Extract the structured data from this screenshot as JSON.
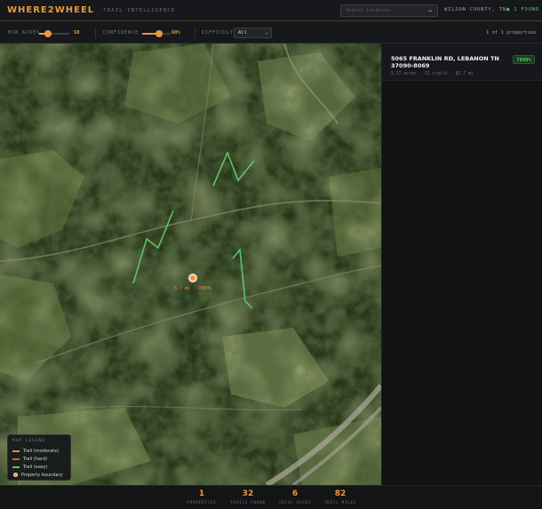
{
  "header": {
    "logo": "WHERE2WHEEL",
    "tagline": "TRAIL INTELLIGENCE",
    "search_placeholder": "Search location...",
    "search_go": "→",
    "county": "WILSON COUNTY, TN",
    "found": "● 1 FOUND"
  },
  "filters": {
    "min_acres": {
      "label": "MIN ACRES",
      "value": "50",
      "level": 0.3
    },
    "confidence": {
      "label": "CONFIDENCE",
      "value": "60%",
      "level": 0.6
    },
    "difficulty": {
      "label": "DIFFICULTY",
      "selected": "All"
    },
    "count": "1 of 1 properties"
  },
  "map": {
    "marker_label": "5.7 mi · 7800%",
    "legend": {
      "title": "MAP LEGEND",
      "items": [
        {
          "label": "Trail (moderate)",
          "color": "#e8893a"
        },
        {
          "label": "Trail (hard)",
          "color": "#d85a4a"
        },
        {
          "label": "Trail (easy)",
          "color": "#5ec46a"
        },
        {
          "label": "Property boundary",
          "color": "#e89a3a"
        }
      ]
    },
    "trail_color": "#5ec46a"
  },
  "panel": {
    "address": "5065 FRANKLIN RD, LEBANON TN 37090-8069",
    "badge": "7800%",
    "meta": [
      "5.37 acres",
      "32 trails",
      "82.7 mi"
    ]
  },
  "stats": [
    {
      "value": "1",
      "label": "PROPERTIES"
    },
    {
      "value": "32",
      "label": "TRAILS FOUND"
    },
    {
      "value": "6",
      "label": "TOTAL ACRES"
    },
    {
      "value": "82",
      "label": "TRAIL MILES"
    }
  ],
  "colors": {
    "accent": "#e89a3a",
    "success": "#5ec46a",
    "bg": "#131416"
  }
}
